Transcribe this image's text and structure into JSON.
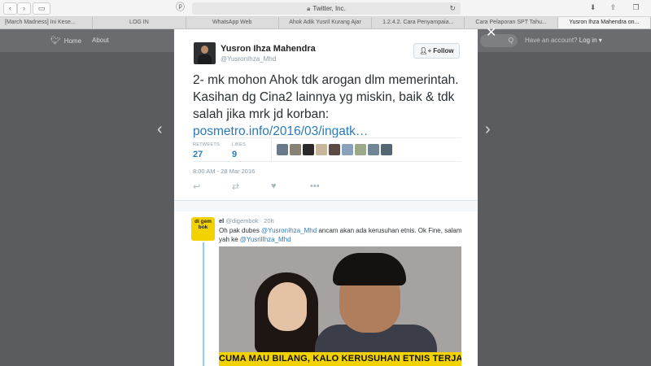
{
  "browser": {
    "address": "Twitter, Inc.",
    "tabs": [
      {
        "label": "[March Madness] Ini Kese..."
      },
      {
        "label": "LOG IN"
      },
      {
        "label": "WhatsApp Web"
      },
      {
        "label": "Ahok Adik Yusril Kurang Ajar"
      },
      {
        "label": "1.2.4.2. Cara Penyampaia..."
      },
      {
        "label": "Cara Pelaporan SPT Tahu..."
      },
      {
        "label": "Yusron Ihza Mahendra on..."
      }
    ]
  },
  "twitter_nav": {
    "home": "Home",
    "about": "About",
    "search_placeholder": "Q",
    "login_prefix": "Have an account?",
    "login": "Log in ▾"
  },
  "tweet": {
    "author_name": "Yusron Ihza Mahendra",
    "author_handle": "@YusronIhza_Mhd",
    "follow_label": "Follow",
    "text": "2- mk mohon Ahok tdk arogan dlm memerintah. Kasihan dg Cina2 lainnya yg miskin, baik & tdk salah jika mrk jd korban:",
    "link": "posmetro.info/2016/03/ingatk…",
    "retweets_label": "RETWEETS",
    "retweets": "27",
    "likes_label": "LIKES",
    "likes": "9",
    "timestamp": "8:00 AM - 28 Mar 2016",
    "liker_colors": [
      "#6a7a8c",
      "#8b8276",
      "#2a2a2a",
      "#c9b59a",
      "#5b4a44",
      "#8aa1bb",
      "#9aaa88",
      "#6e8596",
      "#556677"
    ]
  },
  "reply": {
    "avatar_text": "di gem bok",
    "name": "el",
    "handle": "@digembok",
    "time": "· 20h",
    "text_1": "Oh pak dubes ",
    "mention_1": "@YusronIhza_Mhd",
    "text_2": " ancam akan ada kerusuhan etnis. Ok Fine, salam yah ke ",
    "mention_2": "@YusrilIhza_Mhd",
    "image_caption": "CUMA MAU BILANG, KALO KERUSUHAN ETNIS TERJADI"
  }
}
